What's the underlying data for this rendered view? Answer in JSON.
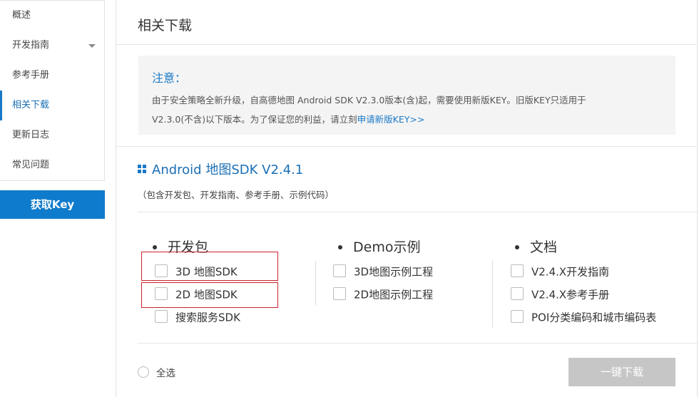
{
  "sidebar": {
    "items": [
      {
        "label": "概述"
      },
      {
        "label": "开发指南"
      },
      {
        "label": "参考手册"
      },
      {
        "label": "相关下载"
      },
      {
        "label": "更新日志"
      },
      {
        "label": "常见问题"
      }
    ],
    "active_item": "相关下载",
    "get_key_label": "获取Key"
  },
  "main": {
    "title": "相关下载",
    "notice": {
      "title": "注意：",
      "line1": "由于安全策略全新升级，自高德地图 Android SDK V2.3.0版本(含)起，需要使用新版KEY。旧版KEY只适用于",
      "line2_prefix": "V2.3.0(不含)以下版本。为了保证您的利益，请立刻",
      "line2_link": "申请新版KEY>>"
    },
    "sdk": {
      "title": "Android 地图SDK V2.4.1",
      "subtitle": "（包含开发包、开发指南、参考手册、示例代码）",
      "columns": [
        {
          "heading": "开发包",
          "items": [
            "3D 地图SDK",
            "2D 地图SDK",
            "搜索服务SDK"
          ]
        },
        {
          "heading": "Demo示例",
          "items": [
            "3D地图示例工程",
            "2D地图示例工程"
          ]
        },
        {
          "heading": "文档",
          "items": [
            "V2.4.X开发指南",
            "V2.4.X参考手册",
            "POI分类编码和城市编码表"
          ]
        }
      ]
    },
    "select_all_label": "全选",
    "download_button_label": "一键下载"
  },
  "colors": {
    "accent": "#1a79c8",
    "get_key_bg": "#0f7bcc",
    "highlight_border": "#c8252b",
    "disabled_button": "#c6c6c6",
    "notice_bg": "#f4f4f4"
  }
}
